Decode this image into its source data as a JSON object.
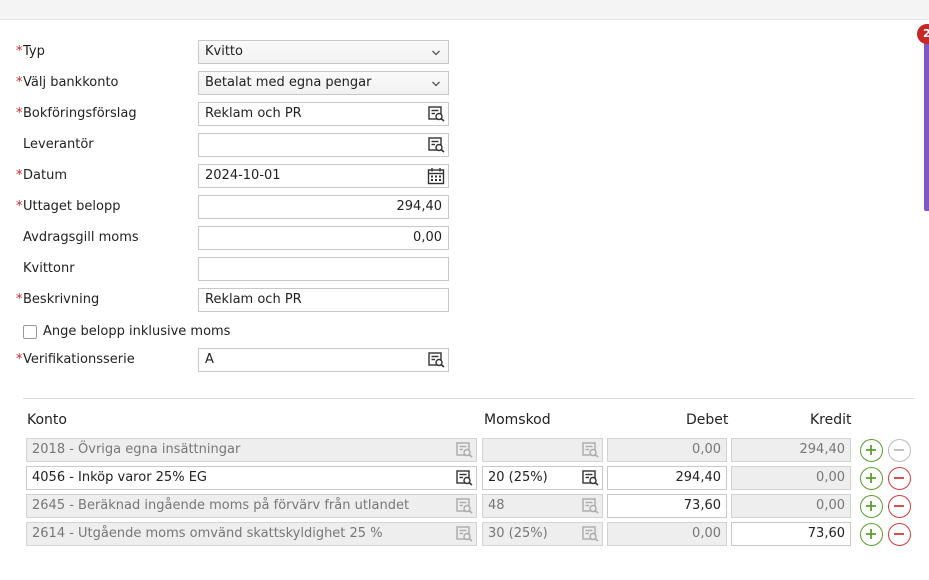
{
  "notification_count": "2",
  "form": {
    "typ": {
      "label": "Typ",
      "value": "Kvitto"
    },
    "bankkonto": {
      "label": "Välj bankkonto",
      "value": "Betalat med egna pengar"
    },
    "bokforingsforslag": {
      "label": "Bokföringsförslag",
      "value": "Reklam och PR"
    },
    "leverantor": {
      "label": "Leverantör",
      "value": ""
    },
    "datum": {
      "label": "Datum",
      "value": "2024-10-01"
    },
    "uttaget_belopp": {
      "label": "Uttaget belopp",
      "value": "294,40"
    },
    "avdragsgill_moms": {
      "label": "Avdragsgill moms",
      "value": "0,00"
    },
    "kvittonr": {
      "label": "Kvittonr",
      "value": ""
    },
    "beskrivning": {
      "label": "Beskrivning",
      "value": "Reklam och PR"
    },
    "inklusive_moms": {
      "label": "Ange belopp inklusive moms",
      "checked": false
    },
    "verifikationsserie": {
      "label": "Verifikationsserie",
      "value": "A"
    }
  },
  "grid": {
    "headers": {
      "konto": "Konto",
      "momskod": "Momskod",
      "debet": "Debet",
      "kredit": "Kredit"
    },
    "rows": [
      {
        "konto": "2018 - Övriga egna insättningar",
        "momskod": "",
        "debet": "0,00",
        "kredit": "294,40"
      },
      {
        "konto": "4056 - Inköp varor 25% EG",
        "momskod": "20 (25%)",
        "debet": "294,40",
        "kredit": "0,00"
      },
      {
        "konto": "2645 - Beräknad ingående moms på förvärv från utlandet",
        "momskod": "48",
        "debet": "73,60",
        "kredit": "0,00"
      },
      {
        "konto": "2614 - Utgående moms omvänd skattskyldighet 25 %",
        "momskod": "30 (25%)",
        "debet": "0,00",
        "kredit": "73,60"
      }
    ]
  },
  "colors": {
    "required": "#c62828",
    "add": "#5a9e2f",
    "remove": "#d33b3b",
    "accent": "#7e57c2"
  }
}
